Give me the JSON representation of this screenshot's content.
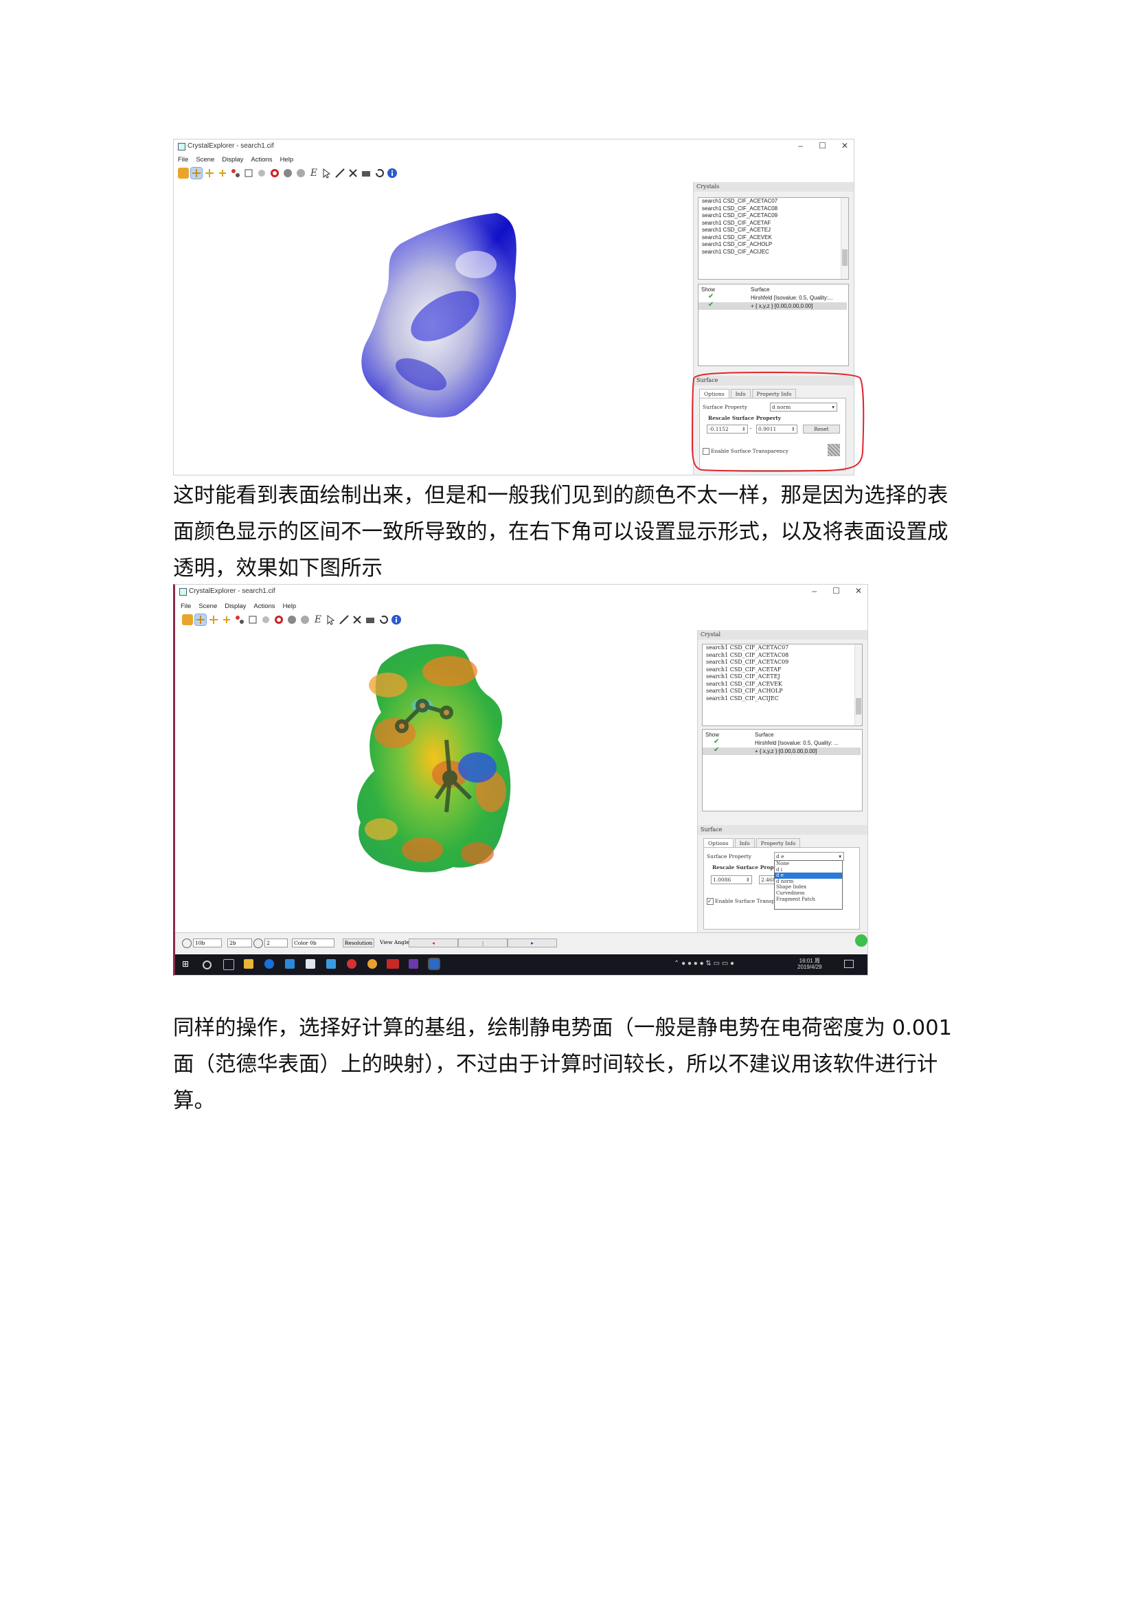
{
  "window1": {
    "title": "CrystalExplorer - search1.cif",
    "controls": {
      "minimize": "–",
      "maximize": "☐",
      "close": "✕"
    },
    "menu": [
      "File",
      "Scene",
      "Display",
      "Actions",
      "Help"
    ],
    "crystals_header": "Crystals",
    "crystals": [
      "search1 CSD_CIF_ACETAC07",
      "search1 CSD_CIF_ACETAC08",
      "search1 CSD_CIF_ACETAC09",
      "search1 CSD_CIF_ACETAF",
      "search1 CSD_CIF_ACETEJ",
      "search1 CSD_CIF_ACEVEK",
      "search1 CSD_CIF_ACHOLP",
      "search1 CSD_CIF_ACIJEC"
    ],
    "surface_table": {
      "col_show": "Show",
      "col_surface": "Surface",
      "rows": [
        "Hirshfeld [Isovalue: 0.5, Quality:...",
        "+ { x,y,z } [0.00,0.00,0.00]"
      ]
    },
    "surface_header": "Surface",
    "tabs": [
      "Options",
      "Info",
      "Property Info"
    ],
    "surface_property_label": "Surface Property",
    "surface_property_value": "d norm",
    "rescale_label": "Rescale Surface Property",
    "min_value": "-0.1152",
    "dash": "–",
    "max_value": "0.9011",
    "reset_label": "Reset",
    "transparency_label": "Enable Surface Transparency",
    "highlight_color": "#e0262e"
  },
  "paragraph1": [
    "这时能看到表面绘制出来，但是和一般我们见到的颜色不太一样，那是因为选择的表",
    "面颜色显示的区间不一致所导致的，在右下角可以设置显示形式，以及将表面设置成",
    "透明，效果如下图所示"
  ],
  "window2": {
    "title": "CrystalExplorer - search1.cif",
    "controls": {
      "minimize": "–",
      "maximize": "☐",
      "close": "✕"
    },
    "menu": [
      "File",
      "Scene",
      "Display",
      "Actions",
      "Help"
    ],
    "crystals_header": "Crystal",
    "crystals": [
      "search1 CSD_CIF_ACETAC07",
      "search1 CSD_CIF_ACETAC08",
      "search1 CSD_CIF_ACETAC09",
      "search1 CSD_CIF_ACETAF",
      "search1 CSD_CIF_ACETEJ",
      "search1 CSD_CIF_ACEVEK",
      "search1 CSD_CIF_ACHOLP",
      "search1 CSD_CIF_ACIJEC"
    ],
    "surface_table": {
      "col_show": "Show",
      "col_surface": "Surface",
      "rows": [
        "Hirshfeld [Isovalue: 0.5, Quality: ...",
        "+ { x,y,z } [0.00,0.00,0.00]"
      ]
    },
    "surface_header": "Surface",
    "tabs": [
      "Options",
      "Info",
      "Property Info"
    ],
    "surface_property_label": "Surface Property",
    "surface_property_value": "d e",
    "rescale_label": "Rescale Surface Property",
    "min_value": "1.0086",
    "max_value": "2.4680",
    "dropdown_options": [
      "None",
      "d i",
      "d e",
      "d norm",
      "Shape Index",
      "Curvedness",
      "Fragment Patch"
    ],
    "dropdown_selected": "d e",
    "transparency_label": "Enable Surface Transparency",
    "status_bar": {
      "field1": "10b",
      "field2": "2b",
      "field3": "2",
      "field4": "Color 0b",
      "label1": "Resolution",
      "label2": "View Angle"
    },
    "clock_time": "16:01 周",
    "clock_date": "2019/4/29"
  },
  "paragraph2": [
    "同样的操作，选择好计算的基组，绘制静电势面（一般是静电势在电荷密度为 0.001",
    "面（范德华表面）上的映射），不过由于计算时间较长，所以不建议用该软件进行计",
    "算。"
  ]
}
